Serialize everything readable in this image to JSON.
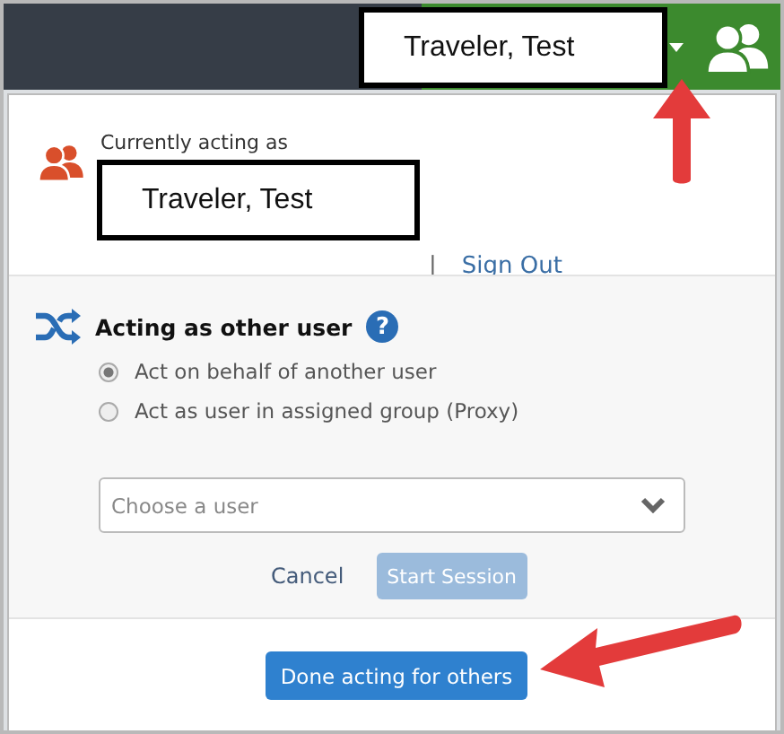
{
  "topbar": {
    "user_label": "Traveler, Test"
  },
  "current": {
    "heading": "Currently acting as",
    "user_label": "Traveler, Test",
    "separator": "|",
    "sign_out": "Sign Out"
  },
  "acting": {
    "title": "Acting as other user",
    "help": "?",
    "options": [
      {
        "label": "Act on behalf of another user",
        "selected": true
      },
      {
        "label": "Act as user in assigned group (Proxy)",
        "selected": false
      }
    ],
    "user_select": {
      "placeholder": "Choose a user"
    },
    "cancel": "Cancel",
    "start": {
      "label": "Start Session",
      "disabled": true
    }
  },
  "done_button": "Done acting for others"
}
